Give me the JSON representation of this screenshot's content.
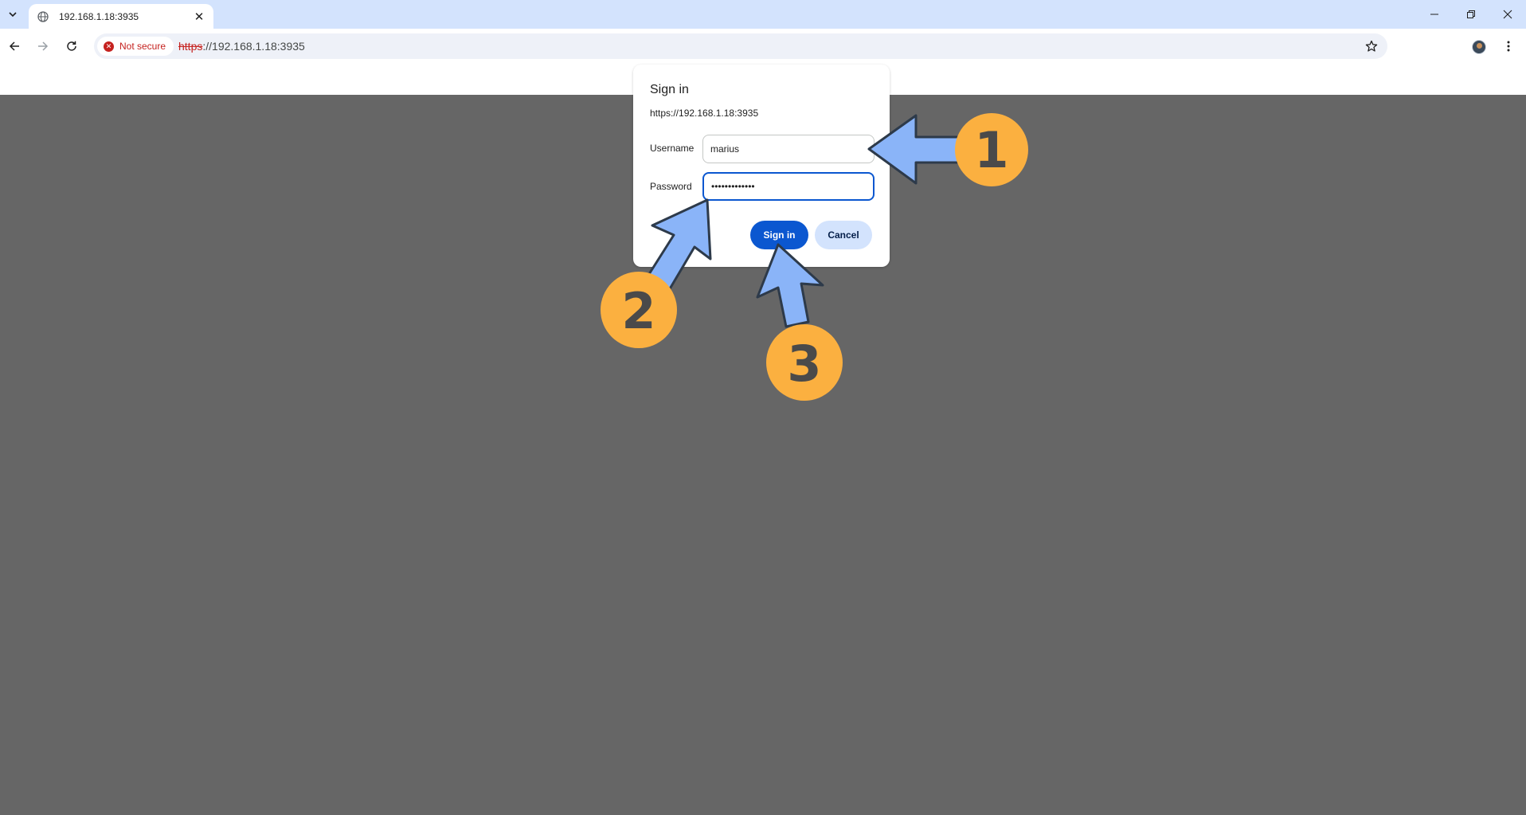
{
  "browser": {
    "tab": {
      "title": "192.168.1.18:3935",
      "globe_icon": "globe-icon"
    },
    "omnibox": {
      "security_chip": "Not secure",
      "url_scheme": "https",
      "url_rest": "://192.168.1.18:3935"
    }
  },
  "dialog": {
    "title": "Sign in",
    "origin": "https://192.168.1.18:3935",
    "username_label": "Username",
    "username_value": "marius",
    "password_label": "Password",
    "password_value": "•••••••••••••",
    "sign_in_label": "Sign in",
    "cancel_label": "Cancel"
  },
  "annotations": {
    "step1": "1",
    "step2": "2",
    "step3": "3",
    "badge_color": "#fbb040",
    "arrow_color": "#8ab4f8"
  }
}
